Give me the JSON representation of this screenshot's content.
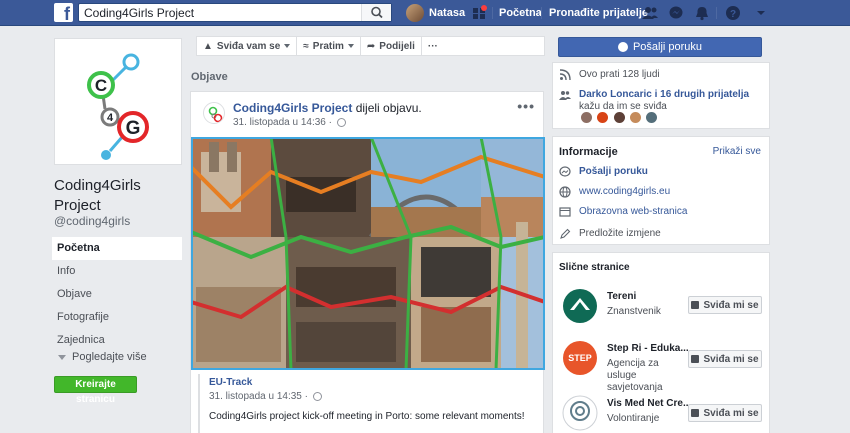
{
  "topbar": {
    "logo_letter": "f",
    "search_value": "Coding4Girls Project",
    "user_name": "Natasa",
    "home_label": "Početna",
    "find_friends_label": "Pronađite prijatelje"
  },
  "page": {
    "name": "Coding4Girls Project",
    "handle": "@coding4girls",
    "logo_letters": [
      "C",
      "4",
      "G"
    ]
  },
  "left_nav": {
    "items": [
      {
        "label": "Početna",
        "active": true
      },
      {
        "label": "Info",
        "active": false
      },
      {
        "label": "Objave",
        "active": false
      },
      {
        "label": "Fotografije",
        "active": false
      },
      {
        "label": "Zajednica",
        "active": false
      }
    ],
    "more_label": "Pogledajte više",
    "create_page_label": "Kreirajte stranicu"
  },
  "action_bar": {
    "like_label": "Sviđa vam se",
    "follow_label": "Pratim",
    "share_label": "Podijeli",
    "more_label": "···"
  },
  "posts_heading": "Objave",
  "post": {
    "author": "Coding4Girls Project",
    "action_text": " dijeli objavu.",
    "timestamp": "31. listopada u 14:36 ·",
    "more": "•••",
    "shared": {
      "title": "EU-Track",
      "timestamp": "31. listopada u 14:35 ·",
      "text": "Coding4Girls project kick-off meeting in Porto: some relevant moments!"
    }
  },
  "sidebar": {
    "message_button": "Pošalji poruku",
    "followers_text": "Ovo prati 128 ljudi",
    "friends_like_link": "Darko Loncaric i 16 drugih prijatelja",
    "friends_like_suffix": " kažu da im se sviđa",
    "info": {
      "heading": "Informacije",
      "show_all": "Prikaži sve",
      "send_message": "Pošalji poruku",
      "website": "www.coding4girls.eu",
      "category": "Obrazovna web-stranica",
      "suggest_edits": "Predložite izmjene"
    },
    "similar": {
      "heading": "Slične stranice",
      "like_label": "Sviđa mi se",
      "items": [
        {
          "name": "Tereni",
          "category": "Znanstvenik"
        },
        {
          "name": "Step Ri - Eduka...",
          "category": "Agencija za usluge savjetovanja"
        },
        {
          "name": "Vis Med Net Cre...",
          "category": "Volontiranje"
        }
      ]
    }
  },
  "colors": {
    "facebook_blue": "#3b5998",
    "button_blue": "#4267b2",
    "link_blue": "#365899",
    "create_green": "#42b72a",
    "background": "#e9ebee"
  }
}
